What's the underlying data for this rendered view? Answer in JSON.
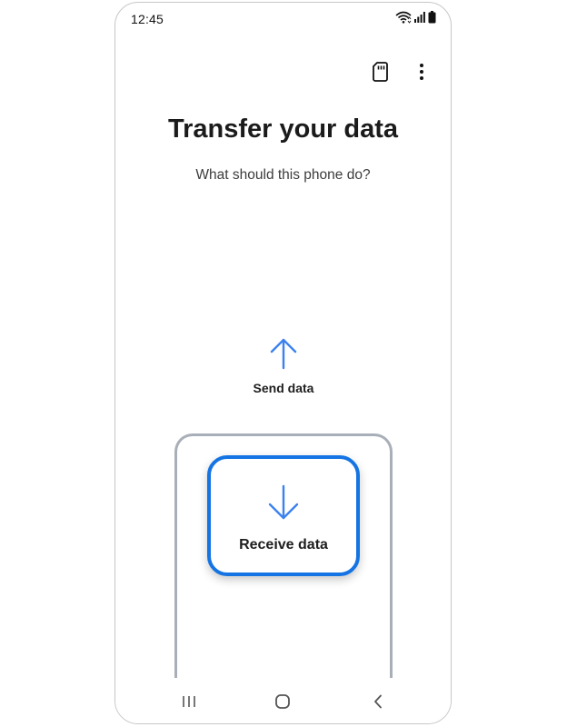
{
  "status_bar": {
    "time": "12:45",
    "icons": [
      "wifi-icon",
      "signal-icon",
      "battery-icon"
    ]
  },
  "header": {
    "actions": [
      "sd-card-icon",
      "more-options-icon"
    ]
  },
  "main": {
    "title": "Transfer your data",
    "subtitle": "What should this phone do?",
    "options": [
      {
        "label": "Send data",
        "icon": "arrow-up-icon",
        "selected": false
      },
      {
        "label": "Receive data",
        "icon": "arrow-down-icon",
        "selected": true
      }
    ]
  },
  "nav_bar": {
    "buttons": [
      "recent-apps-icon",
      "home-icon",
      "back-icon"
    ]
  },
  "colors": {
    "accent": "#1474e3",
    "arrow": "#3b82f0",
    "outline": "#a9afb8"
  }
}
